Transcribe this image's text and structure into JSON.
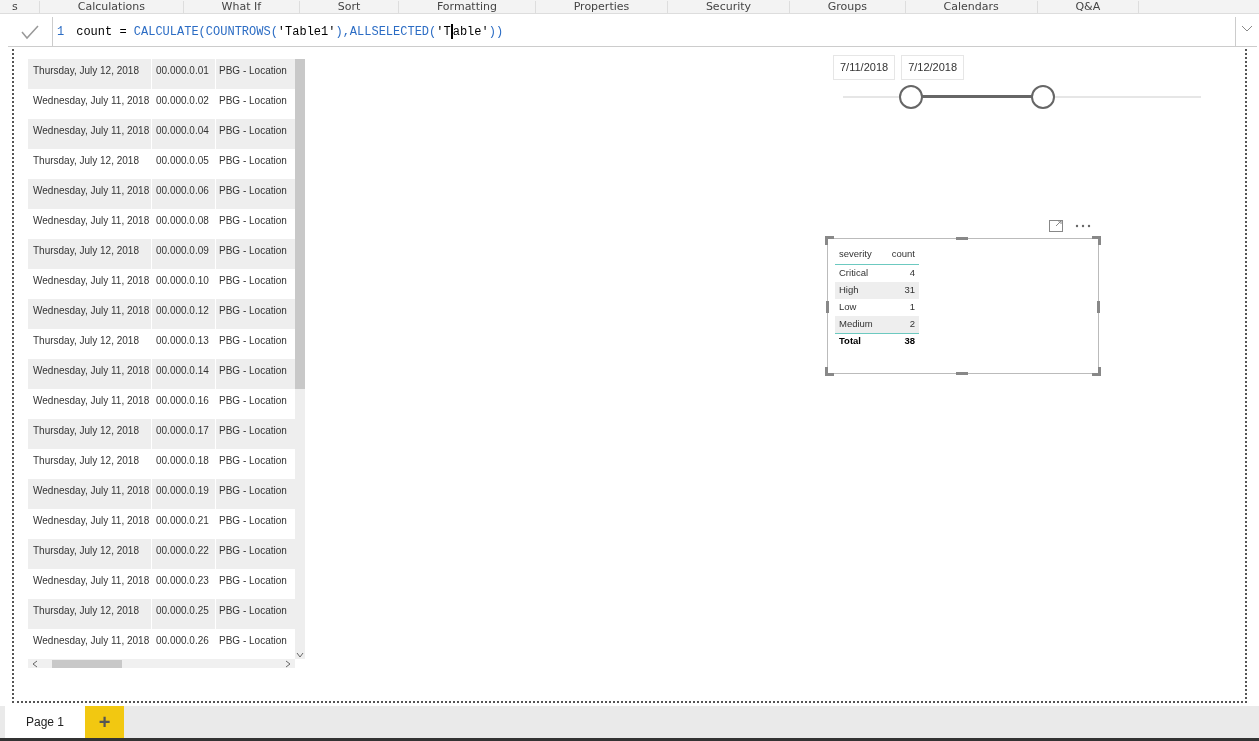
{
  "ribbon": {
    "groups": [
      "s",
      "Calculations",
      "What If",
      "Sort",
      "Formatting",
      "Properties",
      "Security",
      "Groups",
      "Calendars",
      "Q&A"
    ]
  },
  "formula_bar": {
    "line_number": "1",
    "tokens": [
      {
        "kind": "plain",
        "text": "count = "
      },
      {
        "kind": "function",
        "text": "CALCULATE("
      },
      {
        "kind": "function",
        "text": "COUNTROWS("
      },
      {
        "kind": "plain",
        "text": "'Table1'"
      },
      {
        "kind": "function",
        "text": "),ALLSELECTED("
      },
      {
        "kind": "plain",
        "text": "'T"
      },
      {
        "kind": "cursor"
      },
      {
        "kind": "plain",
        "text": "able'"
      },
      {
        "kind": "function",
        "text": "))"
      }
    ]
  },
  "detail_table": {
    "rows": [
      {
        "date": "Thursday, July 12, 2018",
        "id": "00.000.0.01",
        "location": "PBG - Location"
      },
      {
        "date": "Wednesday, July 11, 2018",
        "id": "00.000.0.02",
        "location": "PBG - Location"
      },
      {
        "date": "Wednesday, July 11, 2018",
        "id": "00.000.0.04",
        "location": "PBG - Location"
      },
      {
        "date": "Thursday, July 12, 2018",
        "id": "00.000.0.05",
        "location": "PBG - Location"
      },
      {
        "date": "Wednesday, July 11, 2018",
        "id": "00.000.0.06",
        "location": "PBG - Location"
      },
      {
        "date": "Wednesday, July 11, 2018",
        "id": "00.000.0.08",
        "location": "PBG - Location"
      },
      {
        "date": "Thursday, July 12, 2018",
        "id": "00.000.0.09",
        "location": "PBG - Location"
      },
      {
        "date": "Wednesday, July 11, 2018",
        "id": "00.000.0.10",
        "location": "PBG - Location"
      },
      {
        "date": "Wednesday, July 11, 2018",
        "id": "00.000.0.12",
        "location": "PBG - Location"
      },
      {
        "date": "Thursday, July 12, 2018",
        "id": "00.000.0.13",
        "location": "PBG - Location"
      },
      {
        "date": "Wednesday, July 11, 2018",
        "id": "00.000.0.14",
        "location": "PBG - Location"
      },
      {
        "date": "Wednesday, July 11, 2018",
        "id": "00.000.0.16",
        "location": "PBG - Location"
      },
      {
        "date": "Thursday, July 12, 2018",
        "id": "00.000.0.17",
        "location": "PBG - Location"
      },
      {
        "date": "Thursday, July 12, 2018",
        "id": "00.000.0.18",
        "location": "PBG - Location"
      },
      {
        "date": "Wednesday, July 11, 2018",
        "id": "00.000.0.19",
        "location": "PBG - Location"
      },
      {
        "date": "Wednesday, July 11, 2018",
        "id": "00.000.0.21",
        "location": "PBG - Location"
      },
      {
        "date": "Thursday, July 12, 2018",
        "id": "00.000.0.22",
        "location": "PBG - Location"
      },
      {
        "date": "Wednesday, July 11, 2018",
        "id": "00.000.0.23",
        "location": "PBG - Location"
      },
      {
        "date": "Thursday, July 12, 2018",
        "id": "00.000.0.25",
        "location": "PBG - Location"
      },
      {
        "date": "Wednesday, July 11, 2018",
        "id": "00.000.0.26",
        "location": "PBG - Location"
      }
    ]
  },
  "date_slicer": {
    "start": "7/11/2018",
    "end": "7/12/2018",
    "handles": [
      {
        "level": 0.19
      },
      {
        "level": 0.56
      }
    ]
  },
  "severity_table": {
    "columns": [
      "severity",
      "count"
    ],
    "rows": [
      {
        "severity": "Critical",
        "count": "4"
      },
      {
        "severity": "High",
        "count": "31"
      },
      {
        "severity": "Low",
        "count": "1"
      },
      {
        "severity": "Medium",
        "count": "2"
      }
    ],
    "total": {
      "label": "Total",
      "count": "38"
    }
  },
  "pages": {
    "tabs": [
      {
        "label": "Page 1",
        "selected": true
      }
    ],
    "add": "+"
  }
}
